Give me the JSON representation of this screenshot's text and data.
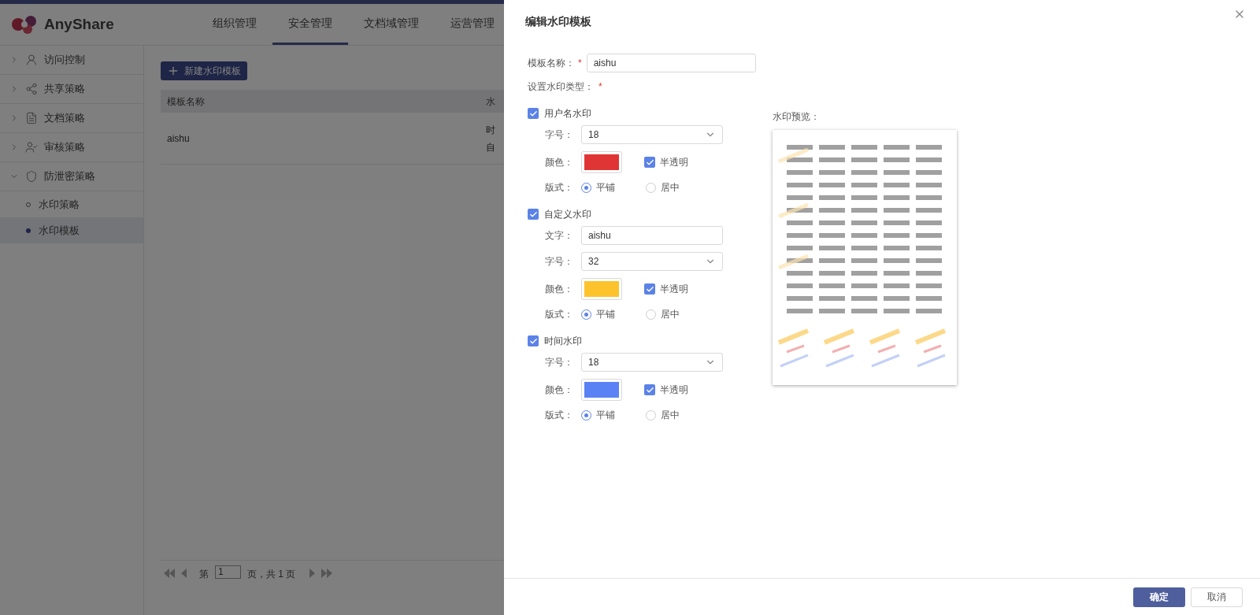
{
  "header": {
    "logo": "AnyShare",
    "nav": [
      {
        "label": "组织管理",
        "selected": false
      },
      {
        "label": "安全管理",
        "selected": true
      },
      {
        "label": "文档域管理",
        "selected": false
      },
      {
        "label": "运营管理",
        "selected": false
      }
    ]
  },
  "sidebar": {
    "items": [
      {
        "kind": "access",
        "label": "访问控制",
        "expanded": false
      },
      {
        "kind": "share",
        "label": "共享策略",
        "expanded": false
      },
      {
        "kind": "document",
        "label": "文档策略",
        "expanded": false
      },
      {
        "kind": "audit",
        "label": "审核策略",
        "expanded": false
      },
      {
        "kind": "shield",
        "label": "防泄密策略",
        "expanded": true,
        "children": [
          {
            "label": "水印策略",
            "selected": false
          },
          {
            "label": "水印模板",
            "selected": true
          }
        ]
      }
    ]
  },
  "main": {
    "new_button": "新建水印模板",
    "table": {
      "columns": [
        "模板名称",
        "水"
      ],
      "rows": [
        {
          "name": "aishu",
          "column_2": [
            "时",
            "自"
          ]
        }
      ]
    },
    "pagination": {
      "prefix": "第",
      "page": "1",
      "suffix": "页，共 1 页"
    }
  },
  "dialog": {
    "title": "编辑水印模板",
    "name_label": "模板名称：",
    "required_mark": "*",
    "name_value": "aishu",
    "type_label": "设置水印类型：",
    "preview_label": "水印预览：",
    "sections": [
      {
        "label": "用户名水印",
        "checked": true,
        "fields": [
          {
            "kind": "select",
            "label": "字号：",
            "value": "18"
          },
          {
            "kind": "color",
            "label": "颜色：",
            "color": "#e03535",
            "translucent": {
              "label": "半透明",
              "checked": true
            }
          },
          {
            "kind": "layout",
            "label": "版式：",
            "options": [
              {
                "label": "平铺",
                "selected": true
              },
              {
                "label": "居中",
                "selected": false
              }
            ]
          }
        ]
      },
      {
        "label": "自定义水印",
        "checked": true,
        "fields": [
          {
            "kind": "text",
            "label": "文字：",
            "value": "aishu"
          },
          {
            "kind": "select",
            "label": "字号：",
            "value": "32"
          },
          {
            "kind": "color",
            "label": "颜色：",
            "color": "#fcc32c",
            "translucent": {
              "label": "半透明",
              "checked": true
            }
          },
          {
            "kind": "layout",
            "label": "版式：",
            "options": [
              {
                "label": "平铺",
                "selected": true
              },
              {
                "label": "居中",
                "selected": false
              }
            ]
          }
        ]
      },
      {
        "label": "时间水印",
        "checked": true,
        "fields": [
          {
            "kind": "select",
            "label": "字号：",
            "value": "18"
          },
          {
            "kind": "color",
            "label": "颜色：",
            "color": "#5b82f5",
            "translucent": {
              "label": "半透明",
              "checked": true
            }
          },
          {
            "kind": "layout",
            "label": "版式：",
            "options": [
              {
                "label": "平铺",
                "selected": true
              },
              {
                "label": "居中",
                "selected": false
              }
            ]
          }
        ]
      }
    ],
    "buttons": [
      {
        "kind": "primary",
        "label": "确定"
      },
      {
        "kind": "secondary",
        "label": "取消"
      }
    ]
  }
}
